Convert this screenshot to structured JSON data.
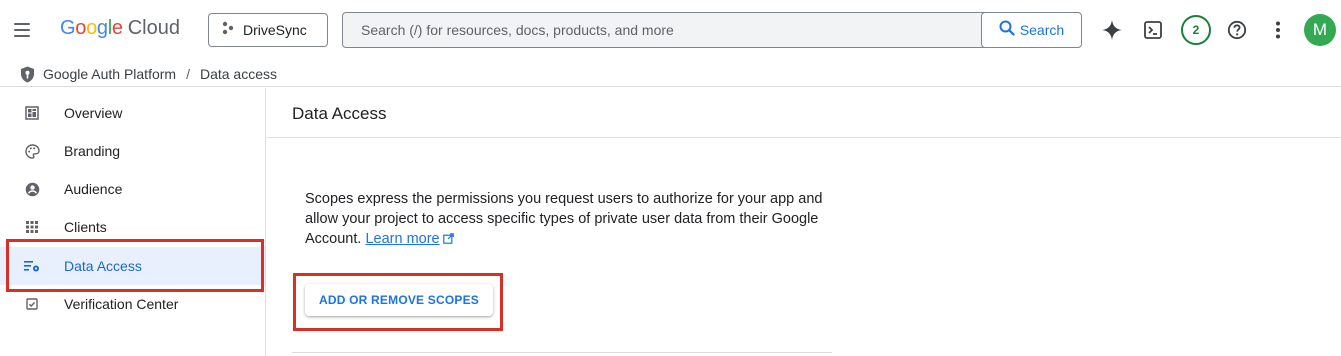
{
  "header": {
    "logo_google": [
      "G",
      "o",
      "o",
      "g",
      "l",
      "e"
    ],
    "logo_google_colors": [
      "#4285f4",
      "#ea4335",
      "#fbbc04",
      "#4285f4",
      "#34a853",
      "#ea4335"
    ],
    "logo_cloud": "Cloud",
    "project_name": "DriveSync",
    "search_placeholder": "Search (/) for resources, docs, products, and more",
    "search_button": "Search",
    "notifications_count": "2",
    "avatar_initial": "M"
  },
  "breadcrumb": {
    "root": "Google Auth Platform",
    "separator": "/",
    "current": "Data access"
  },
  "sidebar": {
    "items": [
      {
        "label": "Overview",
        "icon": "dashboard-icon",
        "active": false
      },
      {
        "label": "Branding",
        "icon": "palette-icon",
        "active": false
      },
      {
        "label": "Audience",
        "icon": "account-circle-icon",
        "active": false
      },
      {
        "label": "Clients",
        "icon": "apps-grid-icon",
        "active": false
      },
      {
        "label": "Data Access",
        "icon": "data-access-icon",
        "active": true
      },
      {
        "label": "Verification Center",
        "icon": "verification-icon",
        "active": false
      }
    ]
  },
  "main": {
    "title": "Data Access",
    "description": "Scopes express the permissions you request users to authorize for your app and allow your project to access specific types of private user data from their Google Account.",
    "learn_more": "Learn more",
    "scopes_button": "ADD OR REMOVE SCOPES"
  },
  "colors": {
    "accent": "#1a73e8",
    "highlight": "#d93025",
    "active_bg": "#e8f0fe",
    "notification": "#188038",
    "avatar_bg": "#34a853"
  }
}
